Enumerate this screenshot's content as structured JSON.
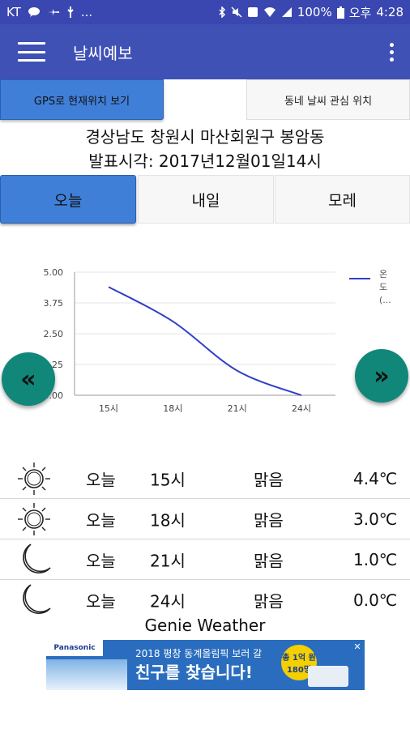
{
  "statusbar": {
    "carrier": "KT",
    "dots": "...",
    "battery": "100%",
    "ampm": "오후",
    "time": "4:28"
  },
  "appbar": {
    "title": "날씨예보"
  },
  "buttons": {
    "gps": "GPS로 현재위치 보기",
    "favorite": "동네 날씨 관심 위치"
  },
  "location": {
    "address": "경상남도 창원시 마산회원구 봉암동",
    "issued": "발표시각: 2017년12월01일14시"
  },
  "tabs": [
    {
      "label": "오늘"
    },
    {
      "label": "내일"
    },
    {
      "label": "모레"
    }
  ],
  "nav": {
    "prev": "«",
    "next": "»"
  },
  "chart_data": {
    "type": "line",
    "categories": [
      "15시",
      "18시",
      "21시",
      "24시"
    ],
    "series": [
      {
        "name": "온도 (…",
        "values": [
          4.4,
          3.0,
          1.0,
          0.0
        ],
        "color": "#3040c8"
      }
    ],
    "yticks": [
      "5.00",
      "3.75",
      "2.50",
      "1.25",
      "0.00"
    ],
    "ylim": [
      0,
      5
    ],
    "grid": true,
    "legend": "right"
  },
  "forecast": [
    {
      "icon": "sun-icon",
      "day": "오늘",
      "hour": "15시",
      "sky": "맑음",
      "temp": "4.4℃"
    },
    {
      "icon": "sun-icon",
      "day": "오늘",
      "hour": "18시",
      "sky": "맑음",
      "temp": "3.0℃"
    },
    {
      "icon": "moon-icon",
      "day": "오늘",
      "hour": "21시",
      "sky": "맑음",
      "temp": "1.0℃"
    },
    {
      "icon": "moon-icon",
      "day": "오늘",
      "hour": "24시",
      "sky": "맑음",
      "temp": "0.0℃"
    }
  ],
  "footer": {
    "text": "Genie Weather"
  },
  "ad": {
    "brand": "Panasonic",
    "line1": "2018 평창 동계올림픽 보러 갈",
    "line2": "친구를 찾습니다!",
    "badge": "총 1억 원 180명",
    "close": "✕"
  }
}
